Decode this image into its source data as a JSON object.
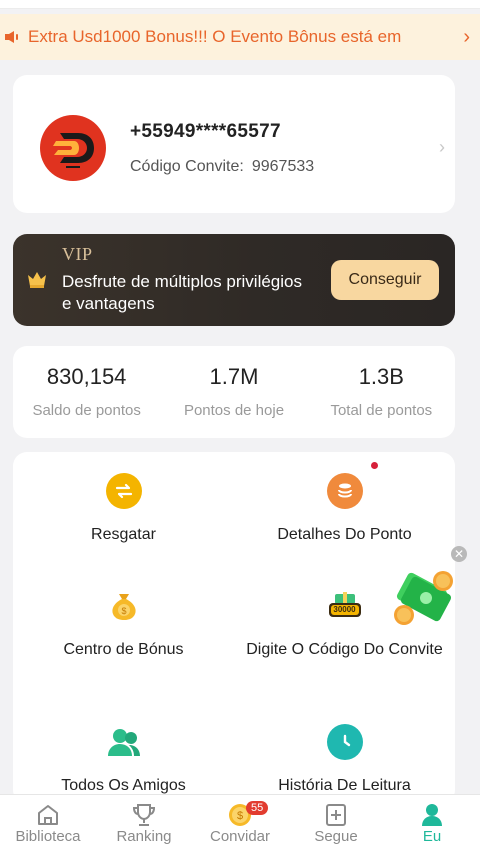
{
  "banner": {
    "text": "Extra Usd1000 Bonus!!! O Evento Bônus está em",
    "icon": "speaker-icon",
    "chevron": "›"
  },
  "profile": {
    "phone": "+55949****65577",
    "invite_label": "Código Convite:",
    "invite_code": "9967533",
    "chevron": "›"
  },
  "vip": {
    "title": "VIP",
    "description": "Desfrute de múltiplos privilégios e vantagens",
    "button": "Conseguir"
  },
  "stats": [
    {
      "value": "830,154",
      "label": "Saldo de pontos"
    },
    {
      "value": "1.7M",
      "label": "Pontos de hoje"
    },
    {
      "value": "1.3B",
      "label": "Total de pontos"
    }
  ],
  "grid": {
    "items": [
      {
        "label": "Resgatar",
        "icon": "exchange-icon",
        "color": "#f4b400"
      },
      {
        "label": "Detalhes Do Ponto",
        "icon": "coin-stack-icon",
        "color": "#f08a3c"
      },
      {
        "label": "Centro de Bónus",
        "icon": "money-bag-icon",
        "color": "#f4b400"
      },
      {
        "label": "Digite O Código Do Convite",
        "icon": "gift-30000-icon",
        "color": "#f4b400",
        "badge_text": "30000"
      },
      {
        "label": "Todos Os Amigos",
        "icon": "friends-icon",
        "color": "#2bbd8a"
      },
      {
        "label": "História De Leitura",
        "icon": "clock-icon",
        "color": "#1fb8b0"
      }
    ]
  },
  "float_close": "✕",
  "nav": {
    "items": [
      {
        "label": "Biblioteca",
        "icon": "home-icon"
      },
      {
        "label": "Ranking",
        "icon": "trophy-icon"
      },
      {
        "label": "Convidar",
        "icon": "coin-icon",
        "badge": "55"
      },
      {
        "label": "Segue",
        "icon": "add-book-icon"
      },
      {
        "label": "Eu",
        "icon": "user-icon",
        "active": true
      }
    ]
  },
  "colors": {
    "accent": "#1fb89a",
    "banner_text": "#e8652b",
    "vip_button": "#f8d7a0"
  }
}
